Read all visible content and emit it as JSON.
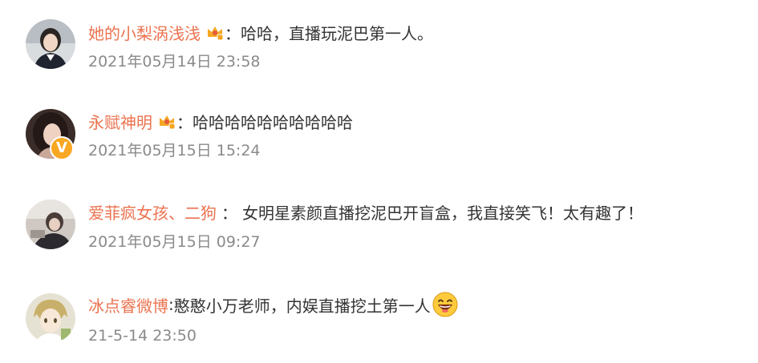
{
  "comments": [
    {
      "username": "她的小梨涡浅浅",
      "has_crown": true,
      "separator": "：",
      "text": "哈哈，直播玩泥巴第一人。",
      "time": "2021年05月14日 23:58",
      "avatar_icon": "avatar-girl-icon"
    },
    {
      "username": "永赋神明",
      "has_crown": true,
      "separator": "：",
      "text": "哈哈哈哈哈哈哈哈哈哈",
      "time": "2021年05月15日 15:24",
      "avatar_icon": "avatar-woman-icon",
      "verified_badge": "V"
    },
    {
      "username": "爱菲疯女孩、二狗",
      "has_crown": false,
      "separator": "：",
      "text": "女明星素颜直播挖泥巴开盲盒，我直接笑飞！太有趣了！",
      "time": "2021年05月15日 09:27",
      "avatar_icon": "avatar-photo-icon"
    },
    {
      "username": "冰点睿微博",
      "has_crown": false,
      "separator": ":",
      "text": "憨憨小万老师，内娱直播挖土第一人",
      "time": "21-5-14 23:50",
      "avatar_icon": "avatar-anime-icon",
      "trailing_emoji": "laughing-emoji-icon"
    }
  ],
  "colors": {
    "username": "#eb7350",
    "text": "#333333",
    "time": "#8a8a8a",
    "verified": "#f9a823",
    "crown": "#f5a623"
  }
}
